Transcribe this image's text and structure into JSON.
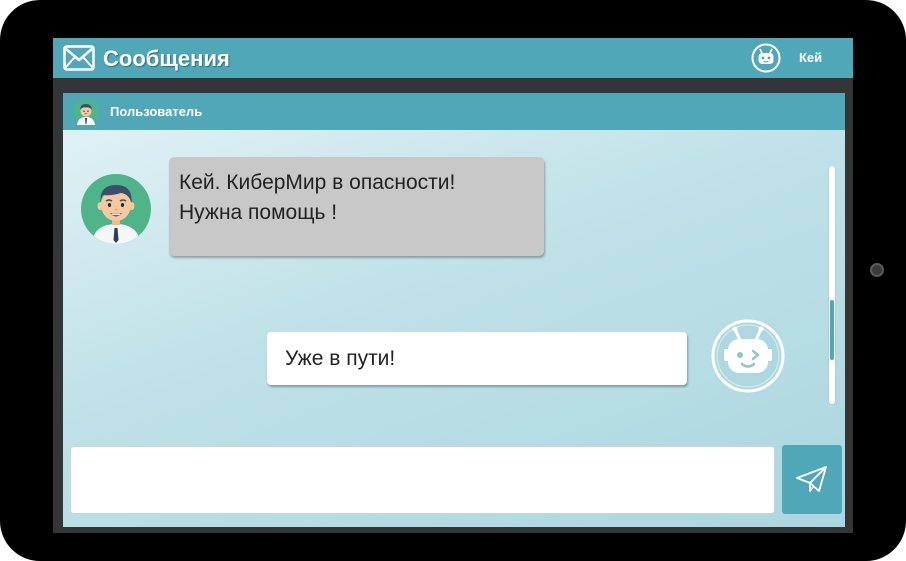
{
  "app": {
    "title": "Сообщения",
    "user_name": "Кей",
    "mail_icon": "envelope-icon",
    "user_badge_icon": "robot-icon"
  },
  "chat": {
    "contact_name": "Пользователь",
    "contact_icon": "user-avatar-icon",
    "messages": [
      {
        "sender": "Пользователь",
        "direction": "incoming",
        "lines": [
          "Кей. КиберМир в опасности!",
          "Нужна помощь !"
        ]
      },
      {
        "sender": "Кей",
        "direction": "outgoing",
        "lines": [
          "Уже в пути!"
        ]
      }
    ],
    "scroll_position": 0.75
  },
  "composer": {
    "value": "",
    "placeholder": "",
    "send_icon": "paper-plane-icon"
  },
  "colors": {
    "accent": "#4fa7b8",
    "screen_bg": "#333537",
    "incoming_bubble": "#c8c8c8",
    "outgoing_bubble": "#ffffff",
    "chat_bg_light": "#e4f3f6",
    "chat_bg_dark": "#acd6df"
  }
}
